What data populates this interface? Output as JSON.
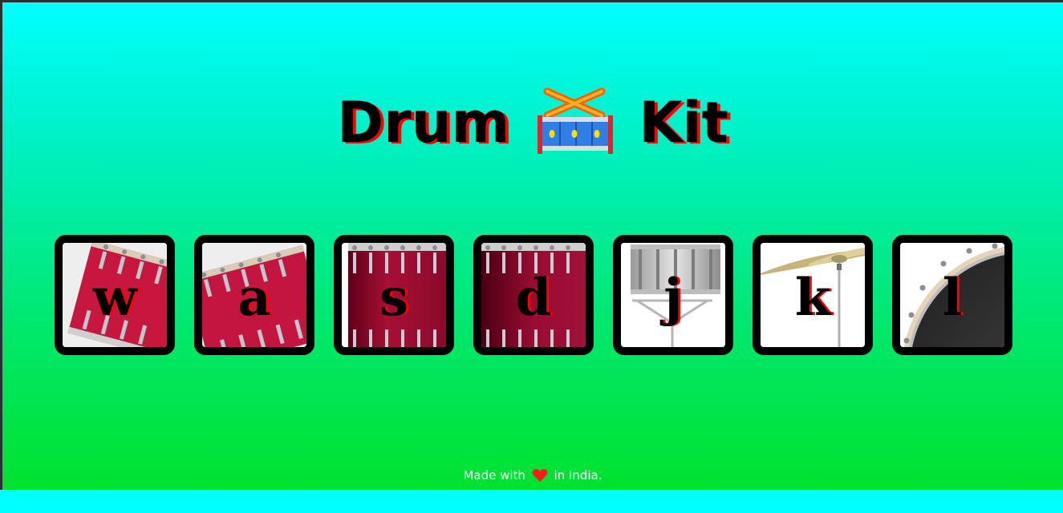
{
  "title": {
    "word_left": "Drum",
    "word_right": "Kit",
    "emoji": "drum-with-drumsticks"
  },
  "drums": [
    {
      "key": "w",
      "image": "tom-1"
    },
    {
      "key": "a",
      "image": "tom-2"
    },
    {
      "key": "s",
      "image": "tom-3"
    },
    {
      "key": "d",
      "image": "tom-4"
    },
    {
      "key": "j",
      "image": "snare"
    },
    {
      "key": "k",
      "image": "crash"
    },
    {
      "key": "l",
      "image": "kick"
    }
  ],
  "footer": {
    "prefix": "Made with",
    "suffix": "in India.",
    "icon": "heart-icon"
  },
  "colors": {
    "gradient_top": "#00ffff",
    "gradient_bottom": "#00e22e",
    "text_shadow": "#ff0000",
    "drum_border": "#000000",
    "footer_text": "#ffffff"
  }
}
